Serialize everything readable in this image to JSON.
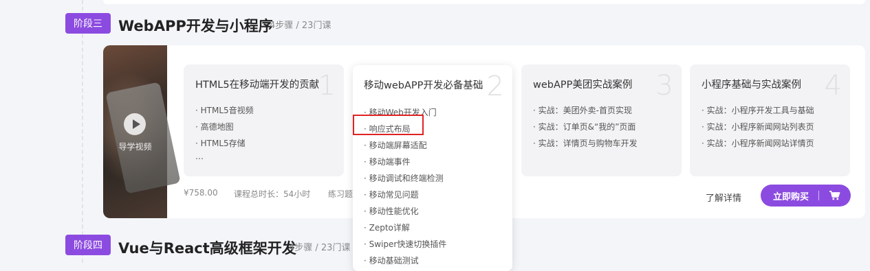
{
  "stage3": {
    "badge": "阶段三",
    "title": "WebAPP开发与小程序",
    "meta": "4步骤 / 23门课"
  },
  "stage4": {
    "badge": "阶段四",
    "title": "Vue与React高级框架开发",
    "meta": "4步骤 / 23门课"
  },
  "thumbnail": {
    "label": "导学视频",
    "icon": "play-icon"
  },
  "steps": [
    {
      "title": "HTML5在移动端开发的贡献",
      "num": "1",
      "items": [
        "· HTML5音视频",
        "· 高德地图",
        "· HTML5存储",
        "…"
      ]
    },
    {
      "title": "移动webAPP开发必备基础",
      "num": "2",
      "items": [
        "· 移动Web开发入门",
        "· 响应式布局",
        "· 移动端屏幕适配",
        "· 移动端事件",
        "· 移动调试和终端检测",
        "· 移动常见问题",
        "· 移动性能优化",
        "· Zepto详解",
        "· Swiper快速切换插件",
        "· 移动基础测试"
      ]
    },
    {
      "title": "webAPP美团实战案例",
      "num": "3",
      "items": [
        "· 实战：美团外卖-首页实现",
        "· 实战：订单页&“我的”页面",
        "· 实战：详情页与购物车开发"
      ]
    },
    {
      "title": "小程序基础与实战案例",
      "num": "4",
      "items": [
        "· 实战：小程序开发工具与基础",
        "· 实战：小程序新闻网站列表页",
        "· 实战：小程序新闻网站详情页"
      ]
    }
  ],
  "footer": {
    "price": "¥758.00",
    "hours": "课程总时长：54小时",
    "exercises": "练习题",
    "learn_more": "了解详情",
    "buy": "立即购买",
    "buy_icon": "cart-icon"
  },
  "colors": {
    "accent": "#8c4be0",
    "highlight": "#e02222"
  }
}
